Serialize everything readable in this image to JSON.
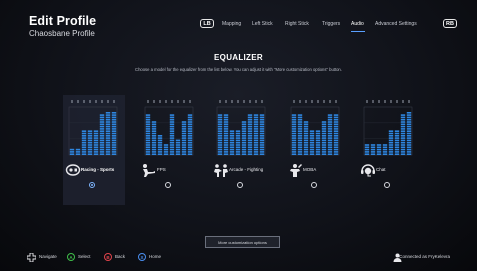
{
  "header": {
    "title": "Edit Profile",
    "subtitle": "Chaosbane Profile"
  },
  "nav": {
    "left_bumper": "LB",
    "right_bumper": "RB",
    "tabs": [
      "Mapping",
      "Left Stick",
      "Right Stick",
      "Triggers",
      "Audio",
      "Advanced Settings"
    ],
    "active_tab": "Audio"
  },
  "main": {
    "heading": "EQUALIZER",
    "description": "Choose a model for the equalizer from the list below. You can adjust it with \"More customization options\" button.",
    "selected_preset": "Racing - Sports",
    "presets": [
      {
        "label": "Racing - Sports",
        "icon": "racing-icon",
        "levels": [
          0.15,
          0.15,
          0.55,
          0.55,
          0.55,
          0.85,
          0.9,
          0.9
        ]
      },
      {
        "label": "FPS",
        "icon": "fps-icon",
        "levels": [
          0.85,
          0.7,
          0.45,
          0.25,
          0.85,
          0.35,
          0.7,
          0.85
        ]
      },
      {
        "label": "Arcade - Fighting",
        "icon": "arcade-icon",
        "levels": [
          0.85,
          0.85,
          0.55,
          0.55,
          0.7,
          0.85,
          0.85,
          0.85
        ]
      },
      {
        "label": "MOBA",
        "icon": "moba-icon",
        "levels": [
          0.85,
          0.85,
          0.7,
          0.55,
          0.55,
          0.7,
          0.85,
          0.85
        ]
      },
      {
        "label": "Chat",
        "icon": "chat-icon",
        "levels": [
          0.25,
          0.25,
          0.25,
          0.25,
          0.55,
          0.55,
          0.85,
          0.9
        ]
      }
    ],
    "more_button": "More customization options"
  },
  "footer": {
    "hints": [
      {
        "button": "dpad-icon",
        "label": "Navigate"
      },
      {
        "button": "A",
        "label": "Select",
        "color": "#3fbf4a"
      },
      {
        "button": "B",
        "label": "Back",
        "color": "#e0434b"
      },
      {
        "button": "X",
        "label": "Home",
        "color": "#4a8ff0"
      }
    ],
    "connection": "Connected as FryKelevra"
  },
  "colors": {
    "eq_bar": "#2e86e0",
    "accent": "#5aa0ff",
    "selected_panel": "#1e2230"
  }
}
